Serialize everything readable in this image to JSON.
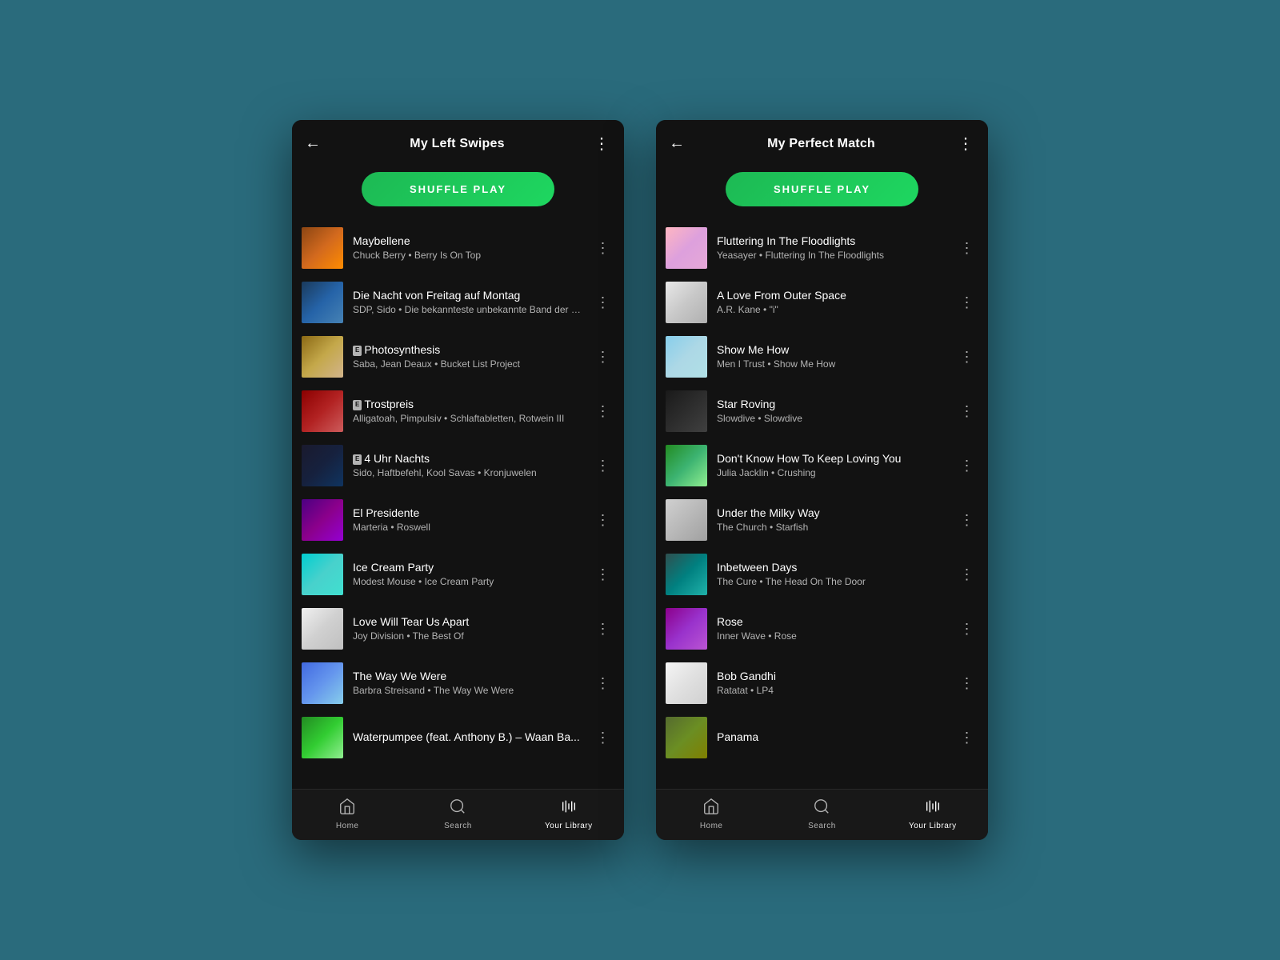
{
  "phone1": {
    "header": {
      "title": "My Left Swipes",
      "back_label": "←",
      "more_label": "⋮"
    },
    "shuffle_label": "SHUFFLE PLAY",
    "songs": [
      {
        "id": "maybellene",
        "title": "Maybellene",
        "subtitle": "Chuck Berry • Berry Is On Top",
        "art_class": "art-maybellene",
        "explicit": false
      },
      {
        "id": "nacht",
        "title": "Die Nacht von Freitag auf Montag",
        "subtitle": "SDP, Sido • Die bekannteste unbekannte Band der Welt",
        "art_class": "art-nacht",
        "explicit": false
      },
      {
        "id": "photo",
        "title": "Photosynthesis",
        "subtitle": "Saba, Jean Deaux • Bucket List Project",
        "art_class": "art-photo",
        "explicit": true
      },
      {
        "id": "trost",
        "title": "Trostpreis",
        "subtitle": "Alligatoah, Pimpulsiv • Schlaftabletten, Rotwein III",
        "art_class": "art-trost",
        "explicit": true
      },
      {
        "id": "uhr",
        "title": "4 Uhr Nachts",
        "subtitle": "Sido, Haftbefehl, Kool Savas • Kronjuwelen",
        "art_class": "art-uhr",
        "explicit": true
      },
      {
        "id": "presidente",
        "title": "El Presidente",
        "subtitle": "Marteria • Roswell",
        "art_class": "art-presidente",
        "explicit": false
      },
      {
        "id": "icecream",
        "title": "Ice Cream Party",
        "subtitle": "Modest Mouse • Ice Cream Party",
        "art_class": "art-icecream",
        "explicit": false
      },
      {
        "id": "love",
        "title": "Love Will Tear Us Apart",
        "subtitle": "Joy Division • The Best Of",
        "art_class": "art-love",
        "explicit": false
      },
      {
        "id": "waywe",
        "title": "The Way We Were",
        "subtitle": "Barbra Streisand • The Way We Were",
        "art_class": "art-way",
        "explicit": false
      },
      {
        "id": "waan",
        "title": "Waterpumpee (feat. Anthony B.) – Waan Ba...",
        "subtitle": "",
        "art_class": "art-waan",
        "explicit": false
      }
    ],
    "nav": {
      "items": [
        {
          "id": "home",
          "label": "Home",
          "icon": "home",
          "active": false
        },
        {
          "id": "search",
          "label": "Search",
          "icon": "search",
          "active": false
        },
        {
          "id": "library",
          "label": "Your Library",
          "icon": "library",
          "active": true
        }
      ]
    }
  },
  "phone2": {
    "header": {
      "title": "My Perfect Match",
      "back_label": "←",
      "more_label": "⋮"
    },
    "shuffle_label": "SHUFFLE PLAY",
    "songs": [
      {
        "id": "flutter",
        "title": "Fluttering In The Floodlights",
        "subtitle": "Yeasayer • Fluttering In The Floodlights",
        "art_class": "art-flutter",
        "explicit": false
      },
      {
        "id": "outer",
        "title": "A Love From Outer Space",
        "subtitle": "A.R. Kane • \"i\"",
        "art_class": "art-outer",
        "explicit": false
      },
      {
        "id": "showme",
        "title": "Show Me How",
        "subtitle": "Men I Trust • Show Me How",
        "art_class": "art-showme",
        "explicit": false
      },
      {
        "id": "star",
        "title": "Star Roving",
        "subtitle": "Slowdive • Slowdive",
        "art_class": "art-star",
        "explicit": false
      },
      {
        "id": "dontknow",
        "title": "Don't Know How To Keep Loving You",
        "subtitle": "Julia Jacklin • Crushing",
        "art_class": "art-dontknow",
        "explicit": false
      },
      {
        "id": "milky",
        "title": "Under the Milky Way",
        "subtitle": "The Church • Starfish",
        "art_class": "art-milky",
        "explicit": false
      },
      {
        "id": "inbetween",
        "title": "Inbetween Days",
        "subtitle": "The Cure • The Head On The Door",
        "art_class": "art-inbetween",
        "explicit": false
      },
      {
        "id": "rose",
        "title": "Rose",
        "subtitle": "Inner Wave • Rose",
        "art_class": "art-rose",
        "explicit": false
      },
      {
        "id": "bob",
        "title": "Bob Gandhi",
        "subtitle": "Ratatat • LP4",
        "art_class": "art-bob",
        "explicit": false
      },
      {
        "id": "panama",
        "title": "Panama",
        "subtitle": "",
        "art_class": "art-panama",
        "explicit": false
      }
    ],
    "nav": {
      "items": [
        {
          "id": "home",
          "label": "Home",
          "icon": "home",
          "active": false
        },
        {
          "id": "search",
          "label": "Search",
          "icon": "search",
          "active": false
        },
        {
          "id": "library",
          "label": "Your Library",
          "icon": "library",
          "active": true
        }
      ]
    }
  }
}
